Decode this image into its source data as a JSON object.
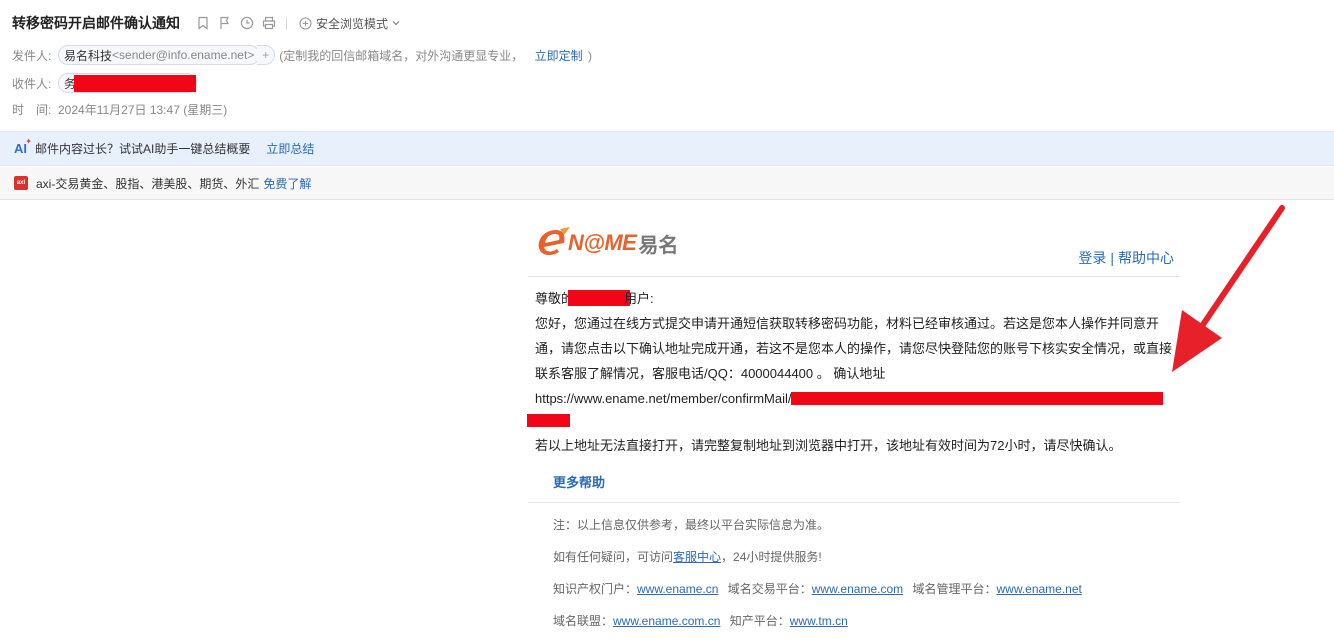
{
  "header": {
    "subject": "转移密码开启邮件确认通知",
    "safe_mode_label": "安全浏览模式",
    "sender_label": "发件人:",
    "sender_name": "易名科技",
    "sender_addr": "<sender@info.ename.net>",
    "sender_plus": "+",
    "tip_prefix": "(定制我的回信邮箱域名，对外沟通更显专业，",
    "tip_link": "立即定制",
    "tip_suffix": ")",
    "recipient_label": "收件人:",
    "recipient_initial": "务",
    "time_label": "时　间:",
    "time_value": "2024年11月27日 13:47 (星期三)"
  },
  "ai_bar": {
    "logo": "AI",
    "text": "邮件内容过长？试试AI助手一键总结概要",
    "link": "立即总结"
  },
  "ad_bar": {
    "logo": "axi",
    "text": "axi-交易黄金、股指、港美股、期货、外汇",
    "link": "免费了解"
  },
  "mail": {
    "brand_name": "N@ME",
    "brand_cn": "易名",
    "login": "登录",
    "divider": "|",
    "help_center": "帮助中心",
    "greeting_prefix": "尊敬的",
    "greeting_suffix": "用户:",
    "para1": "您好，您通过在线方式提交申请开通短信获取转移密码功能，材料已经审核通过。若这是您本人操作并同意开通，请您点击以下确认地址完成开通，若这不是您本人的操作，请您尽快登陆您的账号下核实安全情况，或直接联系客服了解情况，客服电话/QQ：4000044400 。 确认地址",
    "url": "https://www.ename.net/member/confirmMail/",
    "para2": "若以上地址无法直接打开，请完整复制地址到浏览器中打开，该地址有效时间为72小时，请尽快确认。",
    "more_help": "更多帮助",
    "footer": {
      "note": "注：以上信息仅供参考，最终以平台实际信息为准。",
      "q_prefix": "如有任何疑问，可访问",
      "q_link": "客服中心",
      "q_suffix": "，24小时提供服务!",
      "ip_label": "知识产权门户：",
      "ip_link": "www.ename.cn",
      "trade_label": "域名交易平台：",
      "trade_link": "www.ename.com",
      "mgmt_label": "域名管理平台：",
      "mgmt_link": "www.ename.net",
      "union_label": "域名联盟：",
      "union_link": "www.ename.com.cn",
      "tm_label": "知产平台：",
      "tm_link": "www.tm.cn"
    }
  },
  "colors": {
    "accent": "#2a6ab8",
    "redaction": "#f00616",
    "brand_orange": "#e8622c",
    "arrow": "#e8202a"
  }
}
